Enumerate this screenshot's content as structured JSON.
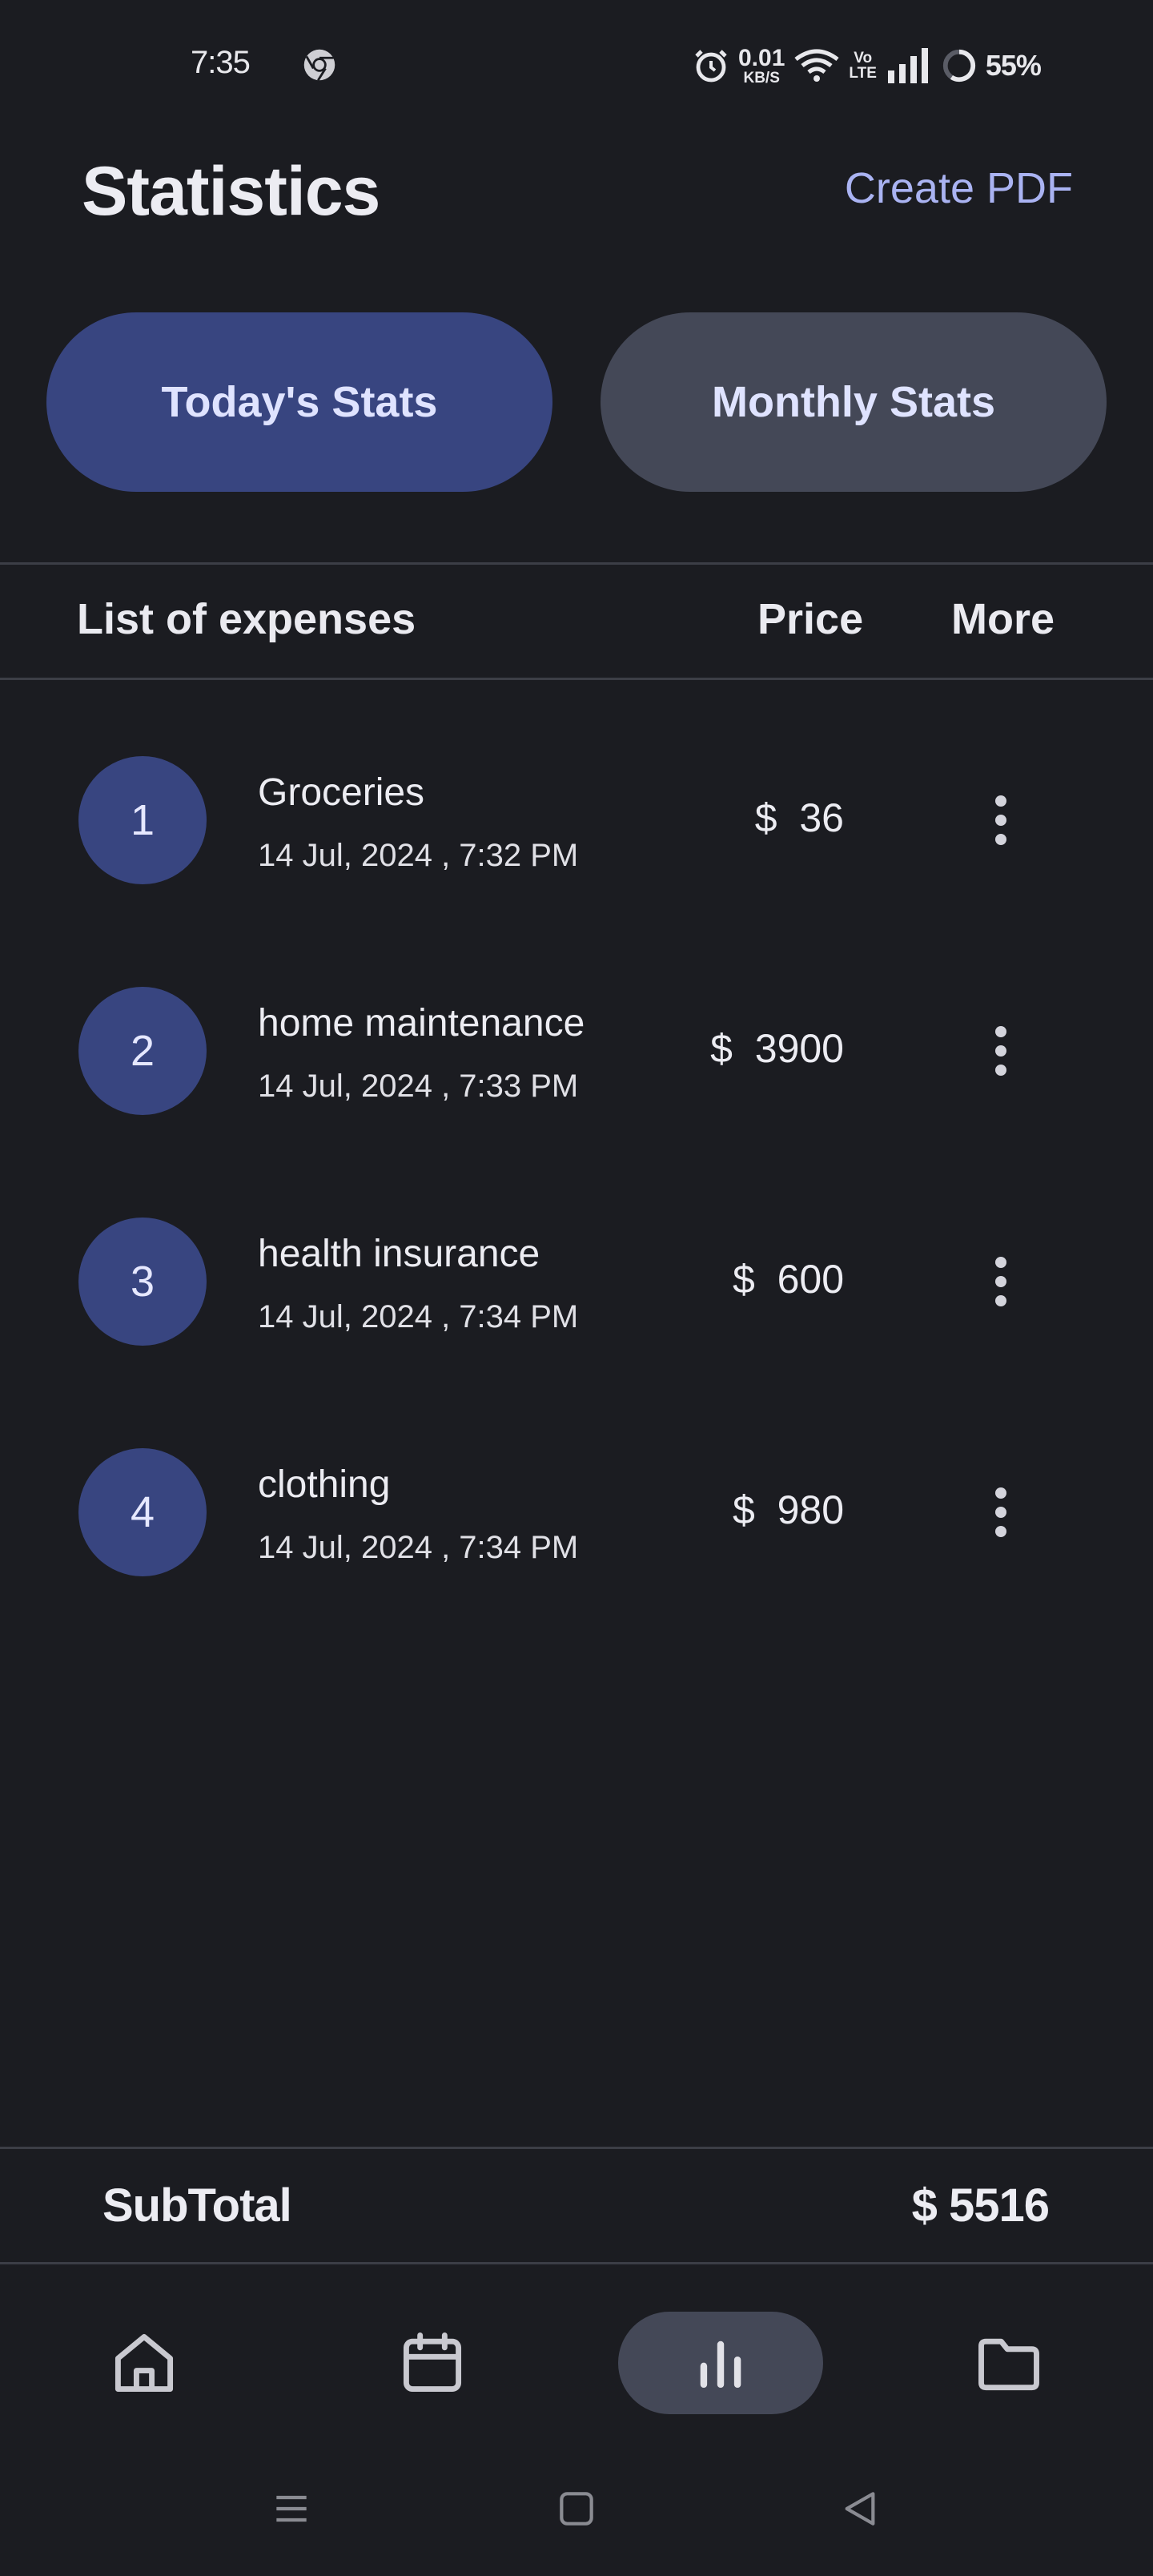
{
  "status_bar": {
    "time": "7:35",
    "net_speed_value": "0.01",
    "net_speed_unit": "KB/S",
    "volte_top": "Vo",
    "volte_bottom": "LTE",
    "battery": "55%"
  },
  "header": {
    "title": "Statistics",
    "create_pdf_label": "Create PDF"
  },
  "tabs": {
    "today_label": "Today's Stats",
    "monthly_label": "Monthly Stats",
    "active": "today"
  },
  "table": {
    "headers": {
      "list": "List of expenses",
      "price": "Price",
      "more": "More"
    },
    "rows": [
      {
        "num": "1",
        "title": "Groceries",
        "date": "14 Jul, 2024 , 7:32 PM",
        "price": "$  36"
      },
      {
        "num": "2",
        "title": "home maintenance",
        "date": "14 Jul, 2024 , 7:33 PM",
        "price": "$  3900"
      },
      {
        "num": "3",
        "title": "health insurance",
        "date": "14 Jul, 2024 , 7:34 PM",
        "price": "$  600"
      },
      {
        "num": "4",
        "title": "clothing",
        "date": "14 Jul, 2024 , 7:34 PM",
        "price": "$  980"
      }
    ]
  },
  "footer": {
    "subtotal_label": "SubTotal",
    "subtotal_value": "$ 5516"
  },
  "bottom_nav": {
    "items": [
      "home-icon",
      "calendar-icon",
      "bar-chart-icon",
      "folder-icon"
    ],
    "active": "bar-chart-icon"
  },
  "system_nav": [
    "menu-icon",
    "home-square-icon",
    "back-triangle-icon"
  ],
  "colors": {
    "background": "#1b1c21",
    "accent": "#384580",
    "tab_inactive": "#444857",
    "link": "#aab3f2"
  }
}
